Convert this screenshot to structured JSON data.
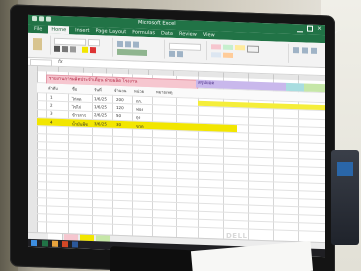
{
  "window": {
    "doc_title": "Microsoft Excel"
  },
  "ribbon": {
    "tabs": [
      "File",
      "Home",
      "Insert",
      "Page Layout",
      "Formulas",
      "Data",
      "Review",
      "View"
    ],
    "active_tab": "Home"
  },
  "formula_bar": {
    "fx": "fx"
  },
  "sheet": {
    "banner_pink": "รายงานการผลิตประจำเดือน ฝ่ายผลิต โรงงาน",
    "banner_purple": "สรุปยอด",
    "headers": [
      "ลำดับ",
      "ชื่อ",
      "วันที่",
      "จำนวน",
      "หน่วย",
      "หมายเหตุ"
    ],
    "rows": [
      [
        "1",
        "ไก่สด",
        "1/6/25",
        "200",
        "กก.",
        ""
      ],
      [
        "2",
        "ไข่ไก่",
        "1/6/25",
        "120",
        "ฟอง",
        ""
      ],
      [
        "3",
        "ข้าวสาร",
        "2/6/25",
        "50",
        "ถุง",
        ""
      ]
    ],
    "highlight_row": [
      "4",
      "น้ำมันพืช",
      "3/6/25",
      "30",
      "ขวด",
      ""
    ]
  },
  "monitor": {
    "brand": "DELL"
  },
  "colors": {
    "excel_green": "#217346",
    "pink": "#f6c6cf",
    "purple": "#c9b8ec",
    "yellow": "#f2e600"
  }
}
